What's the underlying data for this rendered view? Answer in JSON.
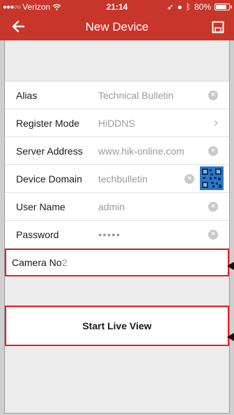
{
  "status_bar": {
    "carrier": "Verizon",
    "time": "21:14",
    "battery": "80%"
  },
  "nav": {
    "title": "New Device",
    "back_icon": "back-arrow-icon",
    "save_icon": "save-icon"
  },
  "form": {
    "rows": [
      {
        "label": "Alias",
        "value": "Technical Bulletin",
        "accessory": "clear-icon"
      },
      {
        "label": "Register Mode",
        "value": "HiDDNS",
        "accessory": "chevron-icon"
      },
      {
        "label": "Server Address",
        "value": "www.hik-online.com",
        "accessory": "clear-icon"
      },
      {
        "label": "Device Domain",
        "value": "techbulletin",
        "accessory": "clear-icon"
      },
      {
        "label": "User Name",
        "value": "admin",
        "accessory": "clear-icon"
      },
      {
        "label": "Password",
        "value": "●●●●●",
        "accessory": "clear-icon"
      },
      {
        "label": "Camera No.",
        "value": "2"
      }
    ]
  },
  "actions": {
    "start_live_view": "Start Live View"
  },
  "colors": {
    "header": "#c8352a",
    "highlight": "#e0202a"
  }
}
